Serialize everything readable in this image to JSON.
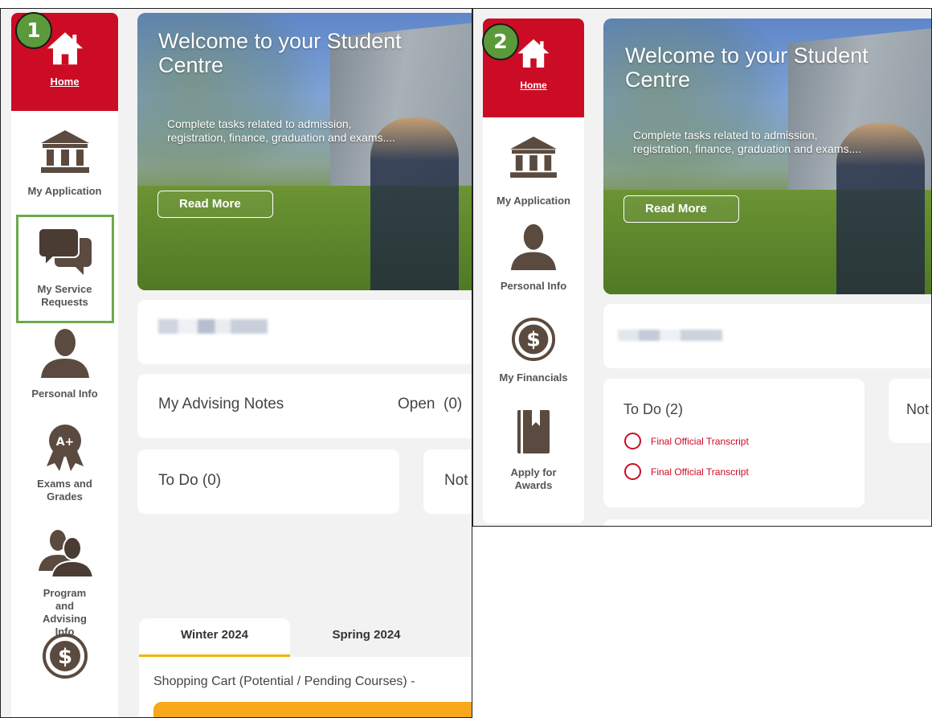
{
  "colors": {
    "brand_red": "#cc0b24",
    "badge_green": "#5a9a3a",
    "highlight_green": "#6aaa4b",
    "tab_underline": "#f0b400",
    "cart_bar": "#f7a81b"
  },
  "panel1": {
    "badge": "1",
    "nav": {
      "home": "Home",
      "my_application": "My Application",
      "my_service_requests": "My Service Requests",
      "personal_info": "Personal Info",
      "exams_and_grades": "Exams and Grades",
      "program_and_advising_info": "Program and Advising Info"
    },
    "hero": {
      "title": "Welcome to your Student Centre",
      "description": "Complete tasks related to admission, registration, finance, graduation and exams....",
      "read_more": "Read More"
    },
    "advising": {
      "title": "My Advising Notes",
      "status": "Open  (0)"
    },
    "todo": {
      "title": "To Do (0)"
    },
    "notifications_partial": "Not",
    "tabs": [
      "Winter 2024",
      "Spring 2024"
    ],
    "shopping_cart": "Shopping Cart (Potential / Pending Courses) -"
  },
  "panel2": {
    "badge": "2",
    "nav": {
      "home": "Home",
      "my_application": "My Application",
      "personal_info": "Personal Info",
      "my_financials": "My Financials",
      "apply_for_awards": "Apply for Awards"
    },
    "hero": {
      "title": "Welcome to your Student Centre",
      "description": "Complete tasks related to admission, registration, finance, graduation and exams....",
      "read_more": "Read More"
    },
    "todo": {
      "title": "To Do (2)",
      "items": [
        "Final Official Transcript",
        "Final Official Transcript"
      ]
    },
    "notifications_partial": "Not"
  }
}
